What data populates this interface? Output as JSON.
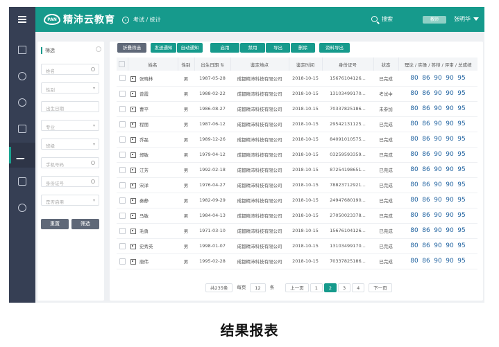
{
  "topbar": {
    "logo_mark": "PAN",
    "logo_text": "精沛云教育",
    "breadcrumb": "考试 / 统计",
    "search_label": "搜索",
    "badge": "教师",
    "user_name": "张明华"
  },
  "filter": {
    "title": "筛选",
    "fields": [
      {
        "placeholder": "姓名",
        "end": "search-icon"
      },
      {
        "placeholder": "性别",
        "end": "▾"
      },
      {
        "placeholder": "出生日期",
        "end": ""
      },
      {
        "placeholder": "专业",
        "end": "▾"
      },
      {
        "placeholder": "班级",
        "end": "▾"
      },
      {
        "placeholder": "手机号码",
        "end": "search-icon"
      },
      {
        "placeholder": "身份证号",
        "end": "search-icon"
      },
      {
        "placeholder": "是否启用",
        "end": "▾"
      }
    ],
    "reset_label": "重置",
    "filter_label": "筛选"
  },
  "toolbar": {
    "collapse_label": "折叠筛选",
    "send_label": "发送通知",
    "auto_label": "自动通知",
    "enable_label": "启用",
    "disable_label": "禁用",
    "export_label": "导出",
    "delete_label": "删除",
    "export_data_label": "资料导出"
  },
  "table": {
    "headers": [
      "姓名",
      "性别",
      "出生日期",
      "鉴定地点",
      "鉴定时间",
      "身份证号",
      "状态",
      "理论 / 实操 / 答辩 / 评审 / 总成绩"
    ],
    "rows": [
      {
        "name": "张晓林",
        "gender": "男",
        "birth": "1987-05-28",
        "place": "成都精沛科技有限公司",
        "time": "2018-10-15",
        "id": "15676104126...",
        "status": "已完成",
        "scores": [
          "80",
          "86",
          "90",
          "90",
          "95"
        ]
      },
      {
        "name": "曾霞",
        "gender": "男",
        "birth": "1988-02-22",
        "place": "成都精沛科技有限公司",
        "time": "2018-10-15",
        "id": "13103499170...",
        "status": "考试中",
        "scores": [
          "80",
          "86",
          "90",
          "90",
          "95"
        ]
      },
      {
        "name": "曹平",
        "gender": "男",
        "birth": "1986-08-27",
        "place": "成都精沛科技有限公司",
        "time": "2018-10-15",
        "id": "70337825186...",
        "status": "未参加",
        "scores": [
          "80",
          "86",
          "90",
          "90",
          "95"
        ]
      },
      {
        "name": "程丽",
        "gender": "男",
        "birth": "1987-06-12",
        "place": "成都精沛科技有限公司",
        "time": "2018-10-15",
        "id": "29542131125...",
        "status": "已完成",
        "scores": [
          "80",
          "86",
          "90",
          "90",
          "95"
        ]
      },
      {
        "name": "乔磊",
        "gender": "男",
        "birth": "1989-12-26",
        "place": "成都精沛科技有限公司",
        "time": "2018-10-15",
        "id": "84091010575...",
        "status": "已完成",
        "scores": [
          "80",
          "86",
          "90",
          "90",
          "95"
        ]
      },
      {
        "name": "郑敏",
        "gender": "男",
        "birth": "1979-04-12",
        "place": "成都精沛科技有限公司",
        "time": "2018-10-15",
        "id": "03259593359...",
        "status": "已完成",
        "scores": [
          "80",
          "86",
          "90",
          "90",
          "95"
        ]
      },
      {
        "name": "江芳",
        "gender": "男",
        "birth": "1992-02-18",
        "place": "成都精沛科技有限公司",
        "time": "2018-10-15",
        "id": "87254198651...",
        "status": "已完成",
        "scores": [
          "80",
          "86",
          "90",
          "90",
          "95"
        ]
      },
      {
        "name": "宋洋",
        "gender": "男",
        "birth": "1976-04-27",
        "place": "成都精沛科技有限公司",
        "time": "2018-10-15",
        "id": "78823712921...",
        "status": "已完成",
        "scores": [
          "80",
          "86",
          "90",
          "90",
          "95"
        ]
      },
      {
        "name": "秦静",
        "gender": "男",
        "birth": "1982-09-29",
        "place": "成都精沛科技有限公司",
        "time": "2018-10-15",
        "id": "24947680190...",
        "status": "已完成",
        "scores": [
          "80",
          "86",
          "90",
          "90",
          "95"
        ]
      },
      {
        "name": "马敏",
        "gender": "男",
        "birth": "1984-04-13",
        "place": "成都精沛科技有限公司",
        "time": "2018-10-15",
        "id": "27050023378...",
        "status": "已完成",
        "scores": [
          "80",
          "86",
          "90",
          "90",
          "95"
        ]
      },
      {
        "name": "毛勇",
        "gender": "男",
        "birth": "1971-03-10",
        "place": "成都精沛科技有限公司",
        "time": "2018-10-15",
        "id": "15676104126...",
        "status": "已完成",
        "scores": [
          "80",
          "86",
          "90",
          "90",
          "95"
        ]
      },
      {
        "name": "史秀英",
        "gender": "男",
        "birth": "1998-01-07",
        "place": "成都精沛科技有限公司",
        "time": "2018-10-15",
        "id": "13103499170...",
        "status": "已完成",
        "scores": [
          "80",
          "86",
          "90",
          "90",
          "95"
        ]
      },
      {
        "name": "唐伟",
        "gender": "男",
        "birth": "1995-02-28",
        "place": "成都精沛科技有限公司",
        "time": "2018-10-15",
        "id": "70337825186...",
        "status": "已完成",
        "scores": [
          "80",
          "86",
          "90",
          "90",
          "95"
        ]
      }
    ]
  },
  "pager": {
    "total": "共235条",
    "per_page_label": "每页",
    "per_page": "12",
    "unit": "条",
    "prev": "上一页",
    "pages": [
      "1",
      "2",
      "3",
      "4"
    ],
    "current": "2",
    "next": "下一页"
  },
  "caption": "结果报表",
  "colors": {
    "accent": "#169a8c",
    "rail": "#363f54",
    "score": "#1b5f9e"
  }
}
